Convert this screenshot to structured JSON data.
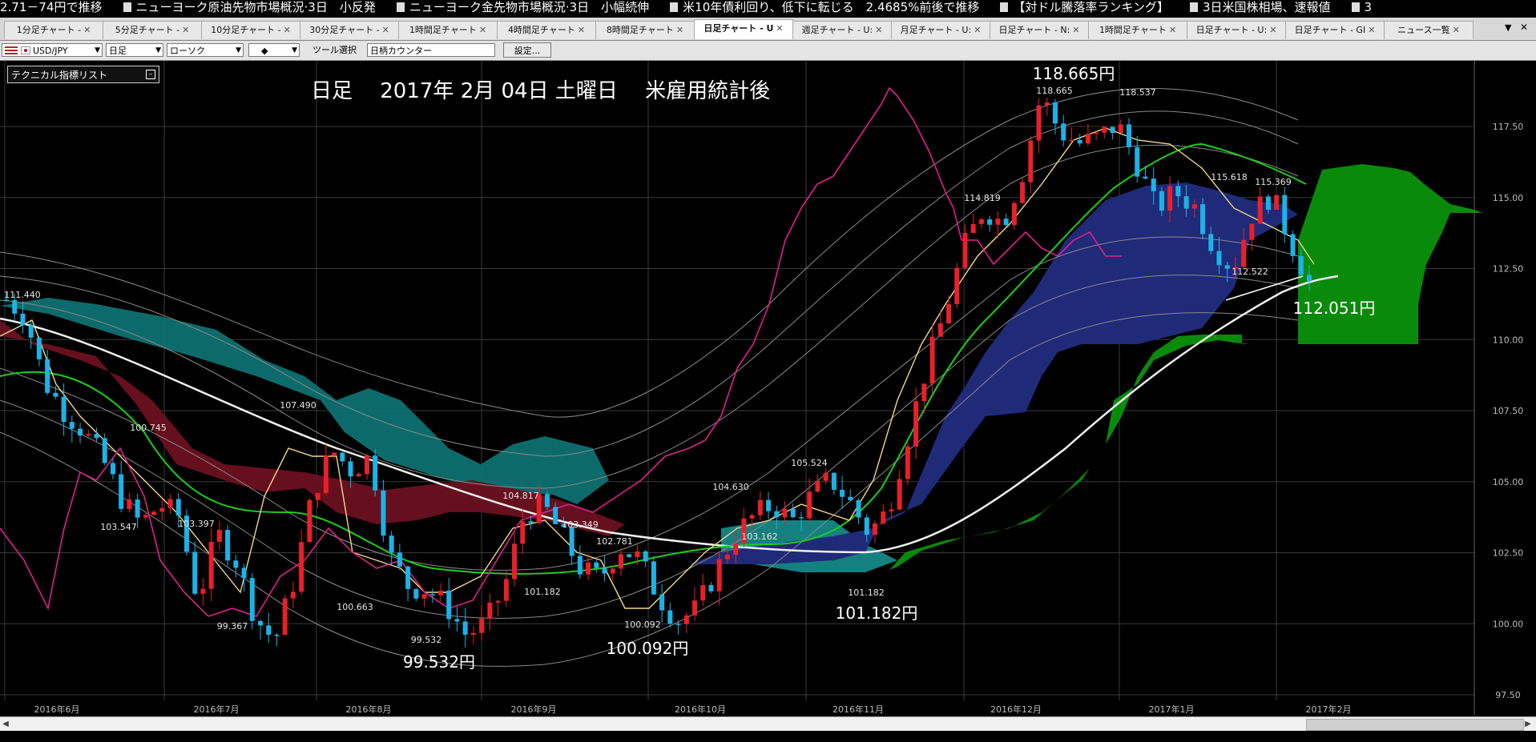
{
  "ticker": {
    "items": [
      "2.71－74円で推移",
      "ニューヨーク原油先物市場概況·3日　小反発",
      "ニューヨーク金先物市場概況·3日　小幅続伸",
      "米10年債利回り、低下に転じる　2.4685%前後で推移",
      "【対ドル騰落率ランキング】",
      "3日米国株相場、速報値",
      "3"
    ]
  },
  "tabs": [
    {
      "label": "1分足チャート -"
    },
    {
      "label": "5分足チャート -"
    },
    {
      "label": "10分足チャート -"
    },
    {
      "label": "30分足チャート -"
    },
    {
      "label": "1時間足チャート"
    },
    {
      "label": "4時間足チャート"
    },
    {
      "label": "8時間足チャート"
    },
    {
      "label": "日足チャート - U"
    },
    {
      "label": "週足チャート - U:"
    },
    {
      "label": "月足チャート - U:"
    },
    {
      "label": "日足チャート - N:"
    },
    {
      "label": "1時間足チャート"
    },
    {
      "label": "日足チャート - U:"
    },
    {
      "label": "日足チャート - GI"
    },
    {
      "label": "ニュース一覧"
    }
  ],
  "toolbar": {
    "pair": "USD/JPY",
    "period": "日足",
    "chart_type": "ローソク",
    "marker": "◆",
    "tool_label": "ツール選択",
    "tool_value": "日柄カウンター",
    "settings": "設定..."
  },
  "indicator_list": "テクニカル指標リスト",
  "chart_title": "日足　 2017年 2月 04日 土曜日　 米雇用統計後",
  "big_labels": [
    "118.665円",
    "112.051円",
    "101.182円",
    "100.092円",
    "99.532円"
  ],
  "small_labels": [
    "111.440",
    "100.745",
    "103.547",
    "103.397",
    "99.367",
    "107.490",
    "100.663",
    "99.532",
    "104.817",
    "101.182",
    "103.349",
    "102.781",
    "100.092",
    "104.630",
    "103.162",
    "105.524",
    "101.182",
    "114.819",
    "118.665",
    "118.537",
    "115.618",
    "115.369",
    "112.522"
  ],
  "y_ticks": [
    "117.50",
    "115.00",
    "112.50",
    "110.00",
    "107.50",
    "105.00",
    "102.50",
    "100.00",
    "97.50"
  ],
  "x_ticks": [
    "2016年6月",
    "2016年7月",
    "2016年8月",
    "2016年9月",
    "2016年10月",
    "2016年11月",
    "2016年12月",
    "2017年1月",
    "2017年2月"
  ],
  "chart_data": {
    "type": "candlestick",
    "instrument": "USD/JPY",
    "timeframe": "日足",
    "ylim": [
      97.5,
      119.5
    ],
    "y_ticks": [
      97.5,
      100,
      102.5,
      105,
      107.5,
      110,
      112.5,
      115,
      117.5
    ],
    "x_categories": [
      "2016年6月",
      "2016年7月",
      "2016年8月",
      "2016年9月",
      "2016年10月",
      "2016年11月",
      "2016年12月",
      "2017年1月",
      "2017年2月"
    ],
    "close_path": [
      111.4,
      110.8,
      108.5,
      107.5,
      106.8,
      105.8,
      104.4,
      103.5,
      104.2,
      103.8,
      100.8,
      103.2,
      102.2,
      100.2,
      99.4,
      101.5,
      104.6,
      106.1,
      105.4,
      105.9,
      102.4,
      101.3,
      101.2,
      100.6,
      99.6,
      100.0,
      101.3,
      103.8,
      104.2,
      103.1,
      101.9,
      101.6,
      102.7,
      102.3,
      101.0,
      100.1,
      100.5,
      101.8,
      103.1,
      103.8,
      104.2,
      103.6,
      104.5,
      105.1,
      104.3,
      103.2,
      104.0,
      106.5,
      109.0,
      111.0,
      113.3,
      114.6,
      114.1,
      115.8,
      118.6,
      117.3,
      116.9,
      117.1,
      117.6,
      116.2,
      114.6,
      115.2,
      114.7,
      113.3,
      112.5,
      114.4,
      115.1,
      113.5,
      112.0
    ],
    "annotated_levels": [
      118.665,
      118.537,
      115.618,
      115.369,
      114.819,
      112.522,
      112.051,
      111.44,
      107.49,
      105.524,
      104.817,
      104.63,
      103.547,
      103.397,
      103.349,
      103.162,
      102.781,
      101.182,
      101.182,
      100.745,
      100.663,
      100.092,
      99.532,
      99.367
    ]
  }
}
